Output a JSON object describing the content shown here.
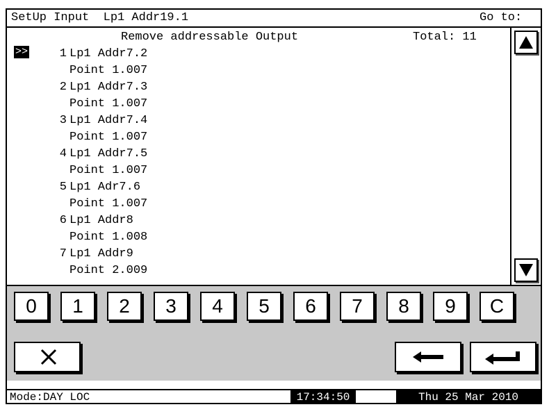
{
  "header": {
    "title": "SetUp Input  Lp1 Addr19.1",
    "goto_label": "Go to:"
  },
  "list": {
    "heading": "Remove addressable Output",
    "total": "Total: 11",
    "selected_marker": ">>",
    "items": [
      {
        "num": "1",
        "addr": "Lp1 Addr7.2",
        "point": "Point 1.007"
      },
      {
        "num": "2",
        "addr": "Lp1 Addr7.3",
        "point": "Point 1.007"
      },
      {
        "num": "3",
        "addr": "Lp1 Addr7.4",
        "point": "Point 1.007"
      },
      {
        "num": "4",
        "addr": "Lp1 Addr7.5",
        "point": "Point 1.007"
      },
      {
        "num": "5",
        "addr": "Lp1 Adr7.6",
        "point": "Point 1.007"
      },
      {
        "num": "6",
        "addr": "Lp1 Addr8",
        "point": "Point 1.008"
      },
      {
        "num": "7",
        "addr": "Lp1 Addr9",
        "point": "Point 2.009"
      }
    ]
  },
  "scrollbar": {
    "up_icon": "triangle-up-icon",
    "down_icon": "triangle-down-icon"
  },
  "keypad": {
    "keys": [
      "0",
      "1",
      "2",
      "3",
      "4",
      "5",
      "6",
      "7",
      "8",
      "9",
      "C"
    ],
    "cancel_icon": "x-icon",
    "backspace_icon": "arrow-left-icon",
    "enter_icon": "enter-arrow-icon"
  },
  "status": {
    "mode": "Mode:DAY LOC",
    "time": "17:34:50",
    "date": "Thu 25 Mar 2010"
  }
}
